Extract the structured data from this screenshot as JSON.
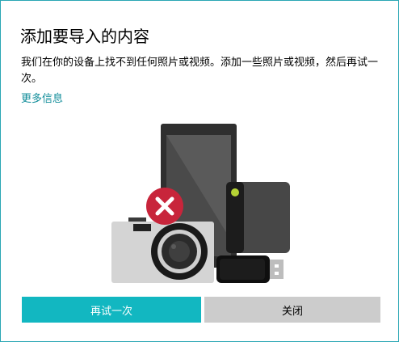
{
  "dialog": {
    "title": "添加要导入的内容",
    "message": "我们在你的设备上找不到任何照片或视频。添加一些照片或视频，然后再试一次。",
    "more_info_link": "更多信息",
    "illustration_icon": "devices-not-found-illustration",
    "error_icon": "error-x-icon"
  },
  "buttons": {
    "retry_label": "再试一次",
    "close_label": "关闭"
  },
  "colors": {
    "accent": "#12b7c1",
    "link": "#0f8c99",
    "error": "#c8253b",
    "secondary_button": "#cccccc"
  }
}
